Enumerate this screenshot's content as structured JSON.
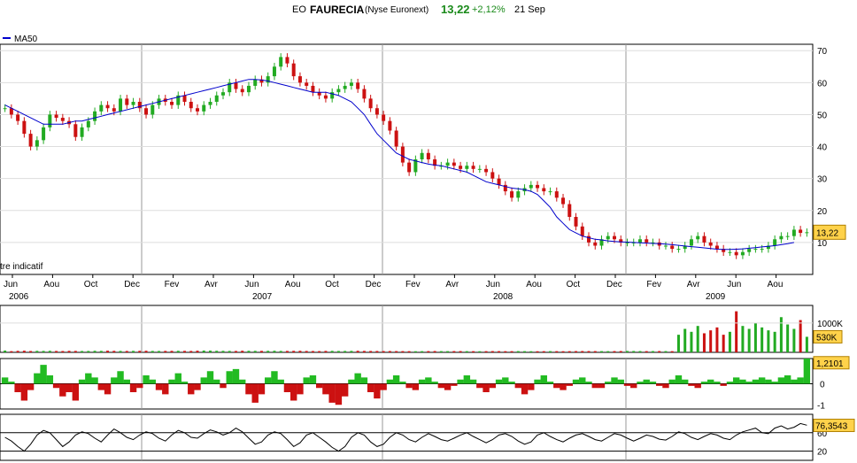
{
  "header": {
    "prefix": "EO",
    "name": "FAURECIA",
    "market": "(Nyse Euronext)",
    "price": "13,22",
    "change": "+2,12%",
    "date": "21 Sep"
  },
  "colors": {
    "up": "#22aa22",
    "down": "#cc1111",
    "ma": "#0000cc",
    "grid": "#888888",
    "price_badge": "#ffd24a",
    "osc_up": "#22bb22",
    "osc_down": "#cc1111"
  },
  "chart_data": [
    {
      "type": "line",
      "panel": "price",
      "legend": "MA50",
      "note": "tre indicatif",
      "last_value_label": "13,22",
      "ylim": [
        0,
        72
      ],
      "yticks": [
        10,
        20,
        30,
        40,
        50,
        60,
        70
      ],
      "months": [
        "Jun",
        "Aou",
        "Oct",
        "Dec",
        "Fev",
        "Avr",
        "Jun",
        "Aou",
        "Oct",
        "Dec",
        "Fev",
        "Avr",
        "Jun",
        "Aou",
        "Oct",
        "Dec",
        "Fev",
        "Avr",
        "Jun",
        "Aou"
      ],
      "years": [
        "2006",
        "2007",
        "2008",
        "2009"
      ],
      "series": [
        {
          "name": "Close",
          "values": [
            52,
            50,
            48,
            44,
            40,
            42,
            46,
            50,
            49,
            48,
            47,
            43,
            46,
            48,
            51,
            53,
            52,
            51,
            55,
            53,
            54,
            52,
            50,
            53,
            55,
            54,
            53,
            56,
            54,
            52,
            51,
            53,
            54,
            56,
            57,
            60,
            58,
            57,
            59,
            61,
            60,
            62,
            65,
            68,
            66,
            62,
            60,
            59,
            57,
            56,
            55,
            57,
            58,
            59,
            60,
            58,
            55,
            52,
            50,
            48,
            45,
            40,
            35,
            32,
            36,
            38,
            36,
            34,
            34,
            35,
            34,
            33,
            34,
            33,
            33,
            32,
            30,
            28,
            26,
            24,
            26,
            27,
            28,
            27,
            26,
            26,
            24,
            22,
            18,
            15,
            12,
            10,
            9,
            11,
            12,
            11,
            10,
            10,
            10,
            11,
            10,
            10,
            9,
            9,
            8,
            8,
            9,
            11,
            12,
            10,
            9,
            8,
            7,
            7,
            6,
            7,
            8,
            8,
            8,
            9,
            11,
            12,
            12,
            14,
            13,
            13.2
          ]
        },
        {
          "name": "MA50",
          "values": [
            53,
            52,
            51,
            50,
            49,
            48,
            47,
            47,
            47,
            47,
            47.5,
            48,
            48,
            48.5,
            49,
            49.5,
            50,
            50.5,
            51,
            51.5,
            52,
            52.5,
            53,
            53.5,
            54,
            54.5,
            55,
            55.5,
            56,
            56.5,
            57,
            57.5,
            58,
            58.5,
            59,
            59.5,
            60,
            60.5,
            61,
            61,
            60.8,
            60.5,
            60,
            59.5,
            59,
            58.5,
            58,
            57.5,
            57,
            57,
            57,
            56.5,
            56,
            55,
            54,
            52,
            50,
            47,
            44,
            42,
            40,
            38,
            37,
            36,
            35.5,
            35,
            34.5,
            34.2,
            34,
            33.5,
            33,
            32.5,
            32,
            31,
            30,
            29,
            28.5,
            28,
            27.5,
            27,
            26.8,
            26.5,
            26,
            25,
            23,
            21,
            18,
            16,
            14,
            13,
            12,
            11.5,
            11,
            10.8,
            10.5,
            10.3,
            10.2,
            10.1,
            10,
            9.9,
            9.8,
            9.7,
            9.6,
            9.5,
            9.3,
            9.1,
            8.9,
            8.7,
            8.5,
            8.3,
            8.1,
            7.9,
            7.8,
            7.8,
            7.9,
            8,
            8.2,
            8.4,
            8.6,
            8.8,
            9,
            9.3,
            9.6,
            10
          ]
        }
      ]
    },
    {
      "type": "bar",
      "panel": "volume",
      "ytick": "1000K",
      "last_value_label": "530K",
      "ylim": [
        0,
        1600
      ],
      "values": [
        60,
        40,
        50,
        55,
        45,
        50,
        48,
        52,
        46,
        44,
        50,
        48,
        45,
        47,
        52,
        49,
        55,
        50,
        48,
        46,
        49,
        51,
        53,
        47,
        46,
        48,
        50,
        52,
        49,
        47,
        55,
        60,
        58,
        52,
        50,
        48,
        46,
        54,
        52,
        50,
        49,
        51,
        53,
        48,
        47,
        50,
        52,
        46,
        44,
        42,
        48,
        50,
        46,
        47,
        49,
        52,
        48,
        46,
        45,
        43,
        44,
        42,
        41,
        40,
        38,
        40,
        42,
        44,
        41,
        40,
        42,
        43,
        40,
        39,
        38,
        40,
        42,
        41,
        39,
        40,
        42,
        40,
        38,
        37,
        39,
        41,
        40,
        38,
        40,
        42,
        44,
        43,
        42,
        41,
        40,
        42,
        44,
        46,
        45,
        43,
        41,
        42,
        44,
        42,
        40,
        600,
        800,
        700,
        900,
        650,
        750,
        850,
        600,
        700,
        1400,
        900,
        800,
        1000,
        850,
        750,
        700,
        1200,
        950,
        800,
        1100,
        530
      ]
    },
    {
      "type": "area",
      "panel": "oscillator",
      "yticks": [
        "0",
        "-1"
      ],
      "last_value_label": "1,2101",
      "ylim": [
        -1.2,
        1.2
      ],
      "values": [
        0.3,
        0.1,
        -0.4,
        -0.8,
        -0.3,
        0.5,
        0.9,
        0.4,
        -0.2,
        -0.6,
        -0.4,
        -0.8,
        0.2,
        0.5,
        0.3,
        -0.3,
        -0.5,
        0.3,
        0.6,
        0.2,
        -0.4,
        -0.2,
        0.4,
        0.2,
        -0.3,
        -0.5,
        0.2,
        0.5,
        0.1,
        -0.5,
        -0.3,
        0.3,
        0.6,
        0.2,
        -0.2,
        0.6,
        0.7,
        0.2,
        -0.5,
        -0.9,
        -0.5,
        0.3,
        0.6,
        0.2,
        -0.4,
        -0.8,
        -0.5,
        0.3,
        0.4,
        -0.2,
        -0.5,
        -0.9,
        -1.0,
        -0.6,
        0.2,
        0.5,
        0.3,
        -0.4,
        -0.7,
        -0.3,
        0.2,
        0.4,
        0.1,
        -0.2,
        -0.3,
        0.2,
        0.3,
        0.1,
        -0.2,
        -0.3,
        -0.1,
        0.2,
        0.4,
        0.2,
        -0.2,
        -0.4,
        -0.2,
        0.2,
        0.3,
        0.1,
        -0.2,
        -0.5,
        -0.3,
        0.2,
        0.4,
        0.1,
        -0.2,
        -0.3,
        -0.1,
        0.2,
        0.3,
        0.1,
        -0.2,
        -0.2,
        0.1,
        0.3,
        0.2,
        -0.1,
        -0.2,
        0.1,
        0.2,
        0.1,
        -0.1,
        -0.2,
        0.2,
        0.4,
        0.2,
        -0.1,
        -0.2,
        0.1,
        0.2,
        0.1,
        -0.1,
        0.1,
        0.3,
        0.2,
        0.1,
        0.2,
        0.3,
        0.2,
        0.1,
        0.3,
        0.4,
        0.2,
        0.3,
        1.2
      ]
    },
    {
      "type": "line",
      "panel": "rsi",
      "yticks": [
        "60",
        "20"
      ],
      "last_value_label": "76,3543",
      "ylim": [
        0,
        100
      ],
      "values": [
        50,
        42,
        30,
        20,
        35,
        55,
        65,
        60,
        45,
        30,
        40,
        55,
        62,
        58,
        48,
        40,
        55,
        68,
        60,
        50,
        45,
        55,
        62,
        58,
        48,
        42,
        55,
        65,
        60,
        50,
        48,
        58,
        66,
        62,
        55,
        60,
        70,
        62,
        48,
        35,
        40,
        55,
        62,
        58,
        45,
        30,
        38,
        55,
        60,
        50,
        40,
        28,
        20,
        30,
        50,
        60,
        55,
        40,
        30,
        35,
        50,
        60,
        55,
        45,
        40,
        50,
        58,
        52,
        45,
        42,
        48,
        55,
        60,
        52,
        45,
        38,
        45,
        55,
        58,
        52,
        42,
        35,
        40,
        55,
        60,
        52,
        45,
        40,
        48,
        55,
        58,
        52,
        45,
        42,
        50,
        58,
        55,
        48,
        42,
        48,
        55,
        52,
        46,
        44,
        52,
        62,
        58,
        50,
        45,
        52,
        58,
        55,
        48,
        45,
        55,
        62,
        66,
        70,
        60,
        58,
        70,
        75,
        68,
        72,
        80,
        76.35
      ]
    }
  ]
}
